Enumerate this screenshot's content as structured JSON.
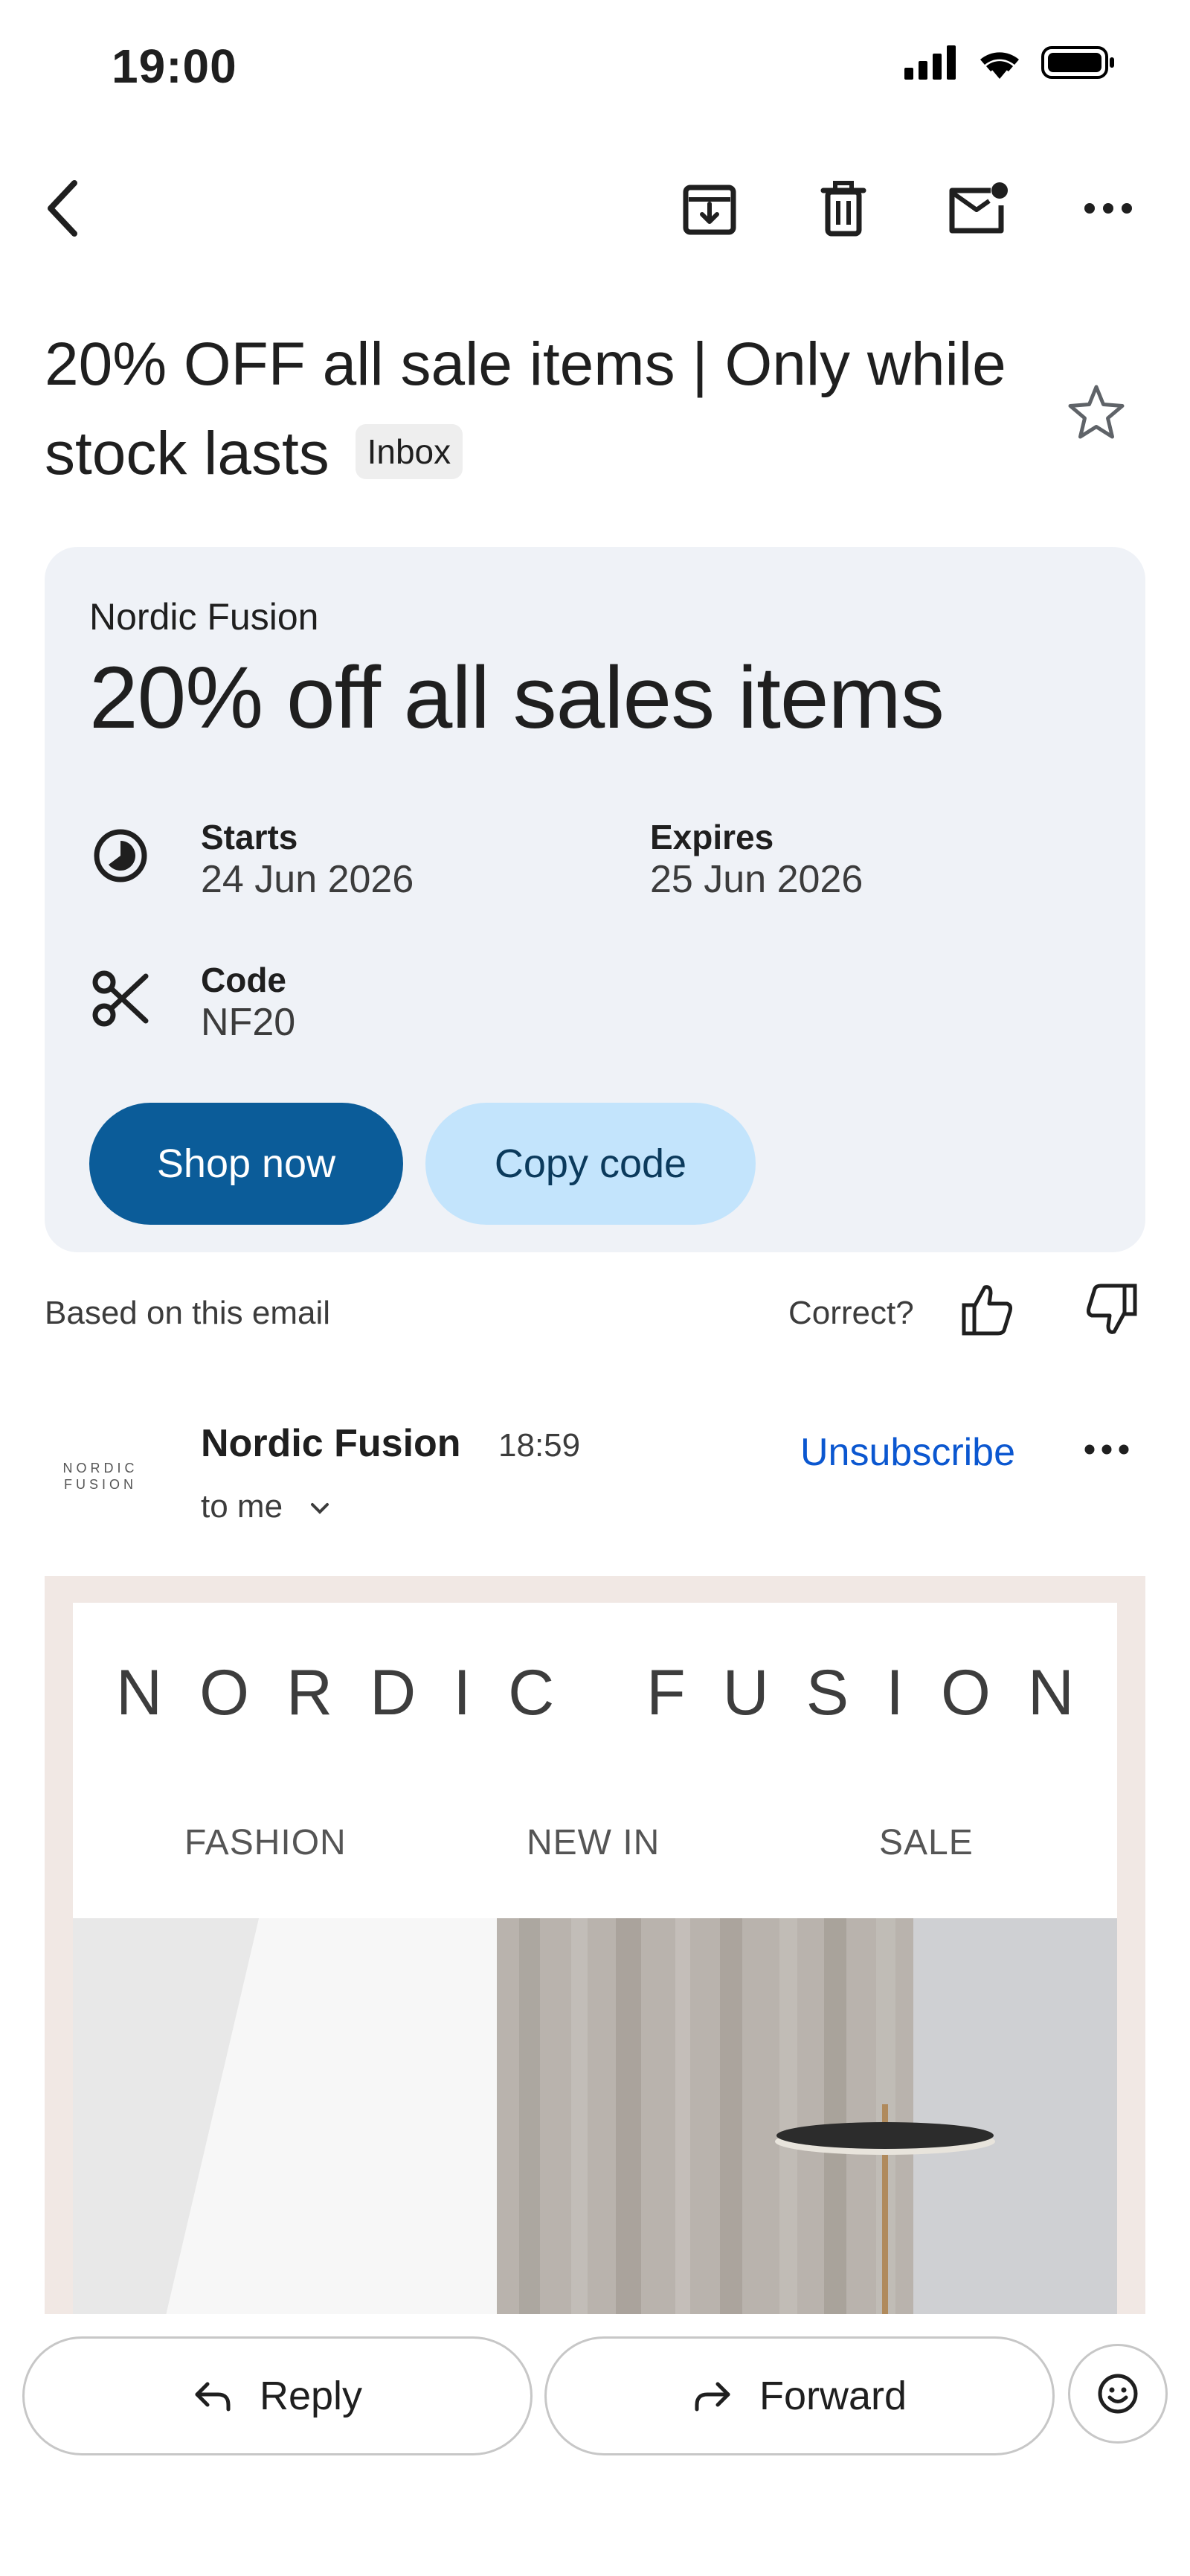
{
  "status_bar": {
    "time": "19:00"
  },
  "toolbar": {
    "icons": [
      "back-arrow-icon",
      "archive-icon",
      "delete-icon",
      "mark-unread-icon",
      "more-icon"
    ]
  },
  "email": {
    "subject": "20% OFF all sale items | Only while stock lasts",
    "label": "Inbox",
    "starred": false
  },
  "promo_card": {
    "sender": "Nordic Fusion",
    "title": "20% off all sales items",
    "starts_label": "Starts",
    "starts_value": "24 Jun 2026",
    "expires_label": "Expires",
    "expires_value": "25 Jun 2026",
    "code_label": "Code",
    "code_value": "NF20",
    "primary_button": "Shop now",
    "secondary_button": "Copy code",
    "colors": {
      "card_bg": "#eff2f7",
      "primary": "#0b5c99",
      "secondary": "#c3e4fc"
    }
  },
  "feedback": {
    "based_on": "Based on this email",
    "correct": "Correct?"
  },
  "message": {
    "sender": "Nordic Fusion",
    "time": "18:59",
    "recipient": "to me",
    "unsubscribe": "Unsubscribe",
    "logo_line1": "NORDIC",
    "logo_line2": "FUSION"
  },
  "email_body": {
    "brand": "NORDIC FUSION",
    "nav": [
      "FASHION",
      "NEW IN",
      "SALE"
    ]
  },
  "actions": {
    "reply": "Reply",
    "forward": "Forward"
  }
}
